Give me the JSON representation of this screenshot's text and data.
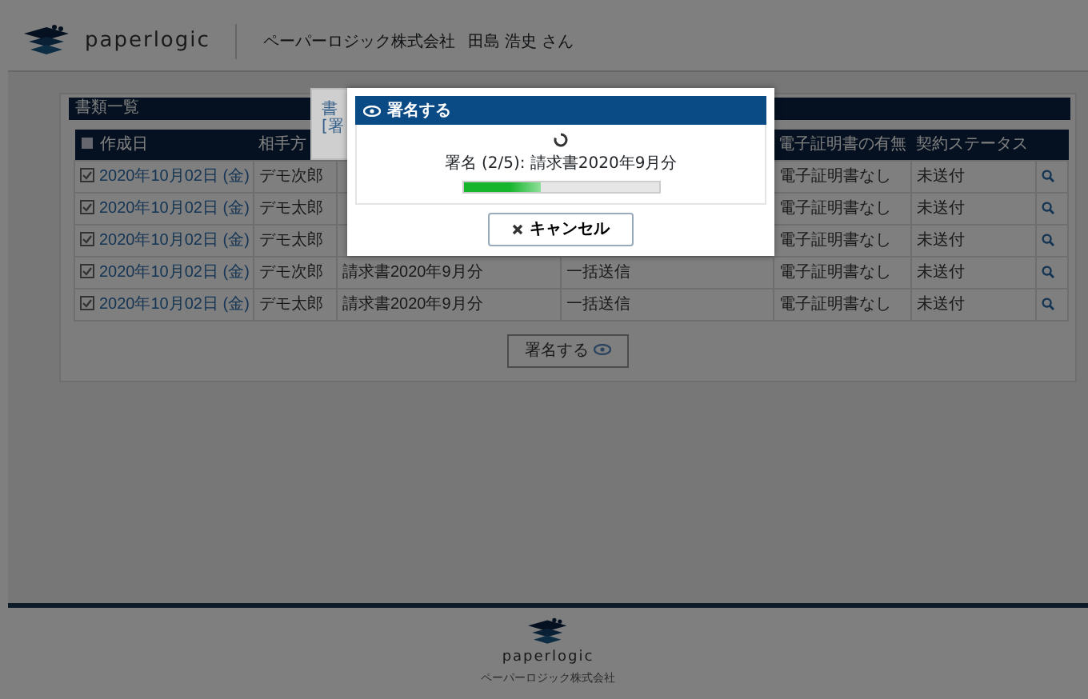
{
  "header": {
    "brand": "paperlogic",
    "company": "ペーパーロジック株式会社",
    "user": "田島 浩史 さん"
  },
  "panel": {
    "title": "書類一覧",
    "columns": {
      "date": "作成日",
      "party": "相手方",
      "certificate": "電子証明書の有無",
      "status": "契約ステータス"
    },
    "rows": [
      {
        "checked": true,
        "date": "2020年10月02日 (金)",
        "party": "デモ次郎",
        "certificate": "電子証明書なし",
        "status": "未送付"
      },
      {
        "checked": true,
        "date": "2020年10月02日 (金)",
        "party": "デモ太郎",
        "certificate": "電子証明書なし",
        "status": "未送付"
      },
      {
        "checked": true,
        "date": "2020年10月02日 (金)",
        "party": "デモ太郎",
        "certificate": "電子証明書なし",
        "status": "未送付"
      },
      {
        "checked": true,
        "date": "2020年10月02日 (金)",
        "party": "デモ次郎",
        "title": "請求書2020年9月分",
        "method": "一括送信",
        "certificate": "電子証明書なし",
        "status": "未送付"
      },
      {
        "checked": true,
        "date": "2020年10月02日 (金)",
        "party": "デモ太郎",
        "title": "請求書2020年9月分",
        "method": "一括送信",
        "certificate": "電子証明書なし",
        "status": "未送付"
      }
    ],
    "sign_button": "署名する"
  },
  "behind_dialog": {
    "lines": [
      "書",
      "[署"
    ]
  },
  "dialog": {
    "title": "署名する",
    "message": "署名 (2/5): 請求書2020年9月分",
    "level": 0.4,
    "cancel": "キャンセル"
  },
  "footer": {
    "brand": "paperlogic",
    "company": "ペーパーロジック株式会社"
  }
}
